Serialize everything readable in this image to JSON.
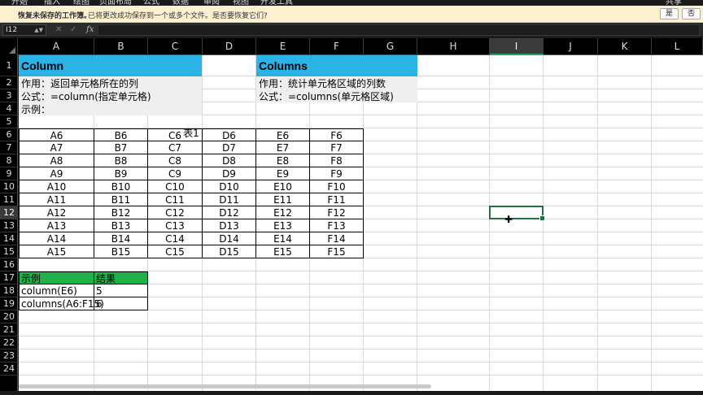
{
  "ribbon": {
    "tabs": [
      "开始",
      "插入",
      "绘图",
      "页面布局",
      "公式",
      "数据",
      "审阅",
      "视图",
      "开发工具"
    ],
    "share_label": "共享"
  },
  "infobar": {
    "title": "恢复未保存的工作簿。",
    "message": "已将更改成功保存到一个或多个文件。是否要恢复它们?",
    "yes": "是",
    "no": "否"
  },
  "formula_bar": {
    "name_box": "I12",
    "fx": "fx",
    "formula": ""
  },
  "columns": [
    "A",
    "B",
    "C",
    "D",
    "E",
    "F",
    "G",
    "H",
    "I",
    "J",
    "K",
    "L"
  ],
  "rows": [
    "1",
    "2",
    "3",
    "4",
    "5",
    "6",
    "7",
    "8",
    "9",
    "10",
    "11",
    "12",
    "13",
    "14",
    "15",
    "16",
    "17",
    "18",
    "19",
    "20",
    "21",
    "22",
    "23",
    "24"
  ],
  "active_col": "I",
  "active_row": "12",
  "sheet": {
    "column_title": "Column",
    "column_usage": "作用：返回单元格所在的列",
    "column_formula": "公式：=column(指定单元格)",
    "example_label": "示例：",
    "columns_title": "Columns",
    "columns_usage": "作用：统计单元格区域的列数",
    "columns_formula": "公式：=columns(单元格区域)",
    "table_caption": "表1",
    "table": [
      [
        "A6",
        "B6",
        "C6",
        "D6",
        "E6",
        "F6"
      ],
      [
        "A7",
        "B7",
        "C7",
        "D7",
        "E7",
        "F7"
      ],
      [
        "A8",
        "B8",
        "C8",
        "D8",
        "E8",
        "F8"
      ],
      [
        "A9",
        "B9",
        "C9",
        "D9",
        "E9",
        "F9"
      ],
      [
        "A10",
        "B10",
        "C10",
        "D10",
        "E10",
        "F10"
      ],
      [
        "A11",
        "B11",
        "C11",
        "D11",
        "E11",
        "F11"
      ],
      [
        "A12",
        "B12",
        "C12",
        "D12",
        "E12",
        "F12"
      ],
      [
        "A13",
        "B13",
        "C13",
        "D13",
        "E13",
        "F13"
      ],
      [
        "A14",
        "B14",
        "C14",
        "D14",
        "E14",
        "F14"
      ],
      [
        "A15",
        "B15",
        "C15",
        "D15",
        "E15",
        "F15"
      ]
    ],
    "results": {
      "header": [
        "示例",
        "结果"
      ],
      "rows": [
        [
          "column(E6)",
          "5"
        ],
        [
          "columns(A6:F15)",
          "6"
        ]
      ]
    }
  },
  "colors": {
    "title_fill": "#2bb2e6",
    "results_header_fill": "#1fb24a",
    "selection": "#217346"
  }
}
